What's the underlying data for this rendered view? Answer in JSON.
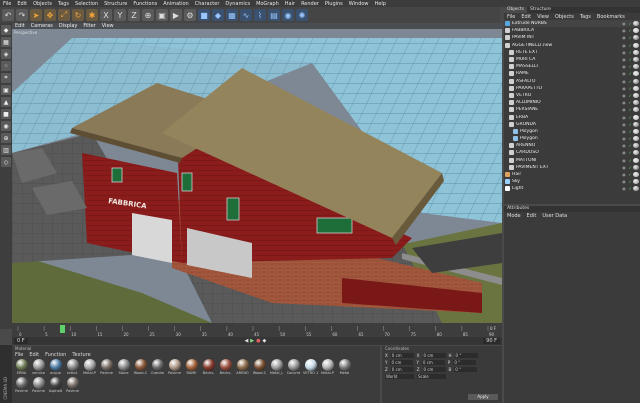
{
  "menubar": [
    "File",
    "Edit",
    "Objects",
    "Tags",
    "Selection",
    "Structure",
    "Functions",
    "Animation",
    "Character",
    "Dynamics",
    "MoGraph",
    "Hair",
    "Render",
    "Plugins",
    "Window",
    "Help"
  ],
  "toolbar_icons": [
    "undo-icon",
    "redo-icon",
    "live-selection-icon",
    "move-icon",
    "scale-icon",
    "rotate-icon",
    "recent-tool-icon",
    "axis-x-icon",
    "axis-y-icon",
    "axis-z-icon",
    "world-coord-icon",
    "render-view-icon",
    "render-picture-icon",
    "render-settings-icon",
    "cube-icon",
    "nurbs-icon",
    "array-icon",
    "spline-icon",
    "deformer-icon",
    "scene-icon",
    "camera-icon",
    "light-icon"
  ],
  "viewport": {
    "menu": [
      "Edit",
      "Cameras",
      "Display",
      "Filter",
      "View"
    ],
    "label": "Perspective"
  },
  "timeline": {
    "ticks": [
      "0",
      "5",
      "10",
      "15",
      "20",
      "25",
      "30",
      "35",
      "40",
      "45",
      "50",
      "55",
      "60",
      "65",
      "70",
      "75",
      "80",
      "85",
      "90"
    ],
    "end_label": "0 F",
    "current_frame": "0 F",
    "end_frame": "90 F"
  },
  "material_manager": {
    "title": "Material",
    "menu": [
      "File",
      "Edit",
      "Function",
      "Texture"
    ],
    "row1": [
      {
        "label": "ERBA",
        "color": "#6f7b55"
      },
      {
        "label": "vernice",
        "color": "#9a9a9a"
      },
      {
        "label": "acqua",
        "color": "#4c7ca4"
      },
      {
        "label": "tetto1",
        "color": "#8a8a8a"
      },
      {
        "label": "Metal-P",
        "color": "#aaaaaa"
      },
      {
        "label": "Pavime",
        "color": "#7a6f66"
      },
      {
        "label": "Stone",
        "color": "#8c8c8c"
      },
      {
        "label": "Wood-C",
        "color": "#8a5a3a"
      },
      {
        "label": "Granite",
        "color": "#6b6b6b"
      },
      {
        "label": "Pavime",
        "color": "#b09a88"
      },
      {
        "label": "RAME",
        "color": "#a5643c"
      },
      {
        "label": "Bricks-",
        "color": "#8a3c2e"
      },
      {
        "label": "Bricks-",
        "color": "#9a5040"
      },
      {
        "label": "ARENO",
        "color": "#8c6c4c"
      },
      {
        "label": "Wood-C",
        "color": "#7a5032"
      },
      {
        "label": "Metal_L",
        "color": "#a0a0a0"
      },
      {
        "label": "Concret",
        "color": "#999999"
      },
      {
        "label": "VETRO 1",
        "color": "#c8dce8"
      },
      {
        "label": "Metal-P",
        "color": "#b4b4b4"
      },
      {
        "label": "Metal",
        "color": "#7c7c7c"
      }
    ],
    "row2": [
      {
        "label": "Pavime",
        "color": "#6c6c6c"
      },
      {
        "label": "Pavime",
        "color": "#8c8c8c"
      },
      {
        "label": "Asphalt",
        "color": "#4a4a4a"
      },
      {
        "label": "Pavime",
        "color": "#7a7068"
      }
    ]
  },
  "coordinates": {
    "title": "Coordinates",
    "rows": [
      {
        "a": "X",
        "av": "0 cm",
        "b": "X",
        "bv": "0 cm",
        "c": "H",
        "cv": "0 °"
      },
      {
        "a": "Y",
        "av": "0 cm",
        "b": "Y",
        "bv": "0 cm",
        "c": "P",
        "cv": "0 °"
      },
      {
        "a": "Z",
        "av": "0 cm",
        "b": "Z",
        "bv": "0 cm",
        "c": "B",
        "cv": "0 °"
      }
    ],
    "mode1": "World",
    "mode2": "Scale",
    "apply": "Apply"
  },
  "objects": {
    "tabs": [
      "Objects",
      "Structure"
    ],
    "menu": [
      "File",
      "Edit",
      "View",
      "Objects",
      "Tags",
      "Bookmarks"
    ],
    "items": [
      {
        "name": "Extrude NURBS",
        "indent": 0,
        "color": "#55a8e0"
      },
      {
        "name": "FABBRICA",
        "indent": 0,
        "color": "#d0d0d0"
      },
      {
        "name": "PAVIM INT",
        "indent": 0,
        "color": "#d0d0d0"
      },
      {
        "name": "AGGETINELLI.new",
        "indent": 0,
        "color": "#d0d0d0"
      },
      {
        "name": "RETE EXT",
        "indent": 1,
        "color": "#d0d0d0"
      },
      {
        "name": "MURI CA",
        "indent": 1,
        "color": "#d0d0d0"
      },
      {
        "name": "MASSELLI",
        "indent": 1,
        "color": "#d0d0d0"
      },
      {
        "name": "RAME",
        "indent": 1,
        "color": "#d0d0d0"
      },
      {
        "name": "ASFALTO",
        "indent": 1,
        "color": "#d0d0d0"
      },
      {
        "name": "PARAPETTO",
        "indent": 1,
        "color": "#d0d0d0"
      },
      {
        "name": "VETRO",
        "indent": 1,
        "color": "#d0d0d0"
      },
      {
        "name": "ALLUMINIO",
        "indent": 1,
        "color": "#d0d0d0"
      },
      {
        "name": "PERSIANE",
        "indent": 1,
        "color": "#d0d0d0"
      },
      {
        "name": "ERBA",
        "indent": 1,
        "color": "#d0d0d0"
      },
      {
        "name": "GRONDA",
        "indent": 1,
        "color": "#d0d0d0"
      },
      {
        "name": "Polygon",
        "indent": 2,
        "color": "#8fc0e8"
      },
      {
        "name": "Polygon",
        "indent": 2,
        "color": "#8fc0e8"
      },
      {
        "name": "ARENNO",
        "indent": 1,
        "color": "#d0d0d0"
      },
      {
        "name": "CARDOSO",
        "indent": 1,
        "color": "#d0d0d0"
      },
      {
        "name": "MATTONI",
        "indent": 1,
        "color": "#d0d0d0"
      },
      {
        "name": "PAVIMENT EXT",
        "indent": 1,
        "color": "#d0d0d0"
      },
      {
        "name": "Hair",
        "indent": 0,
        "color": "#e0a060"
      },
      {
        "name": "Sky",
        "indent": 0,
        "color": "#9ad0ff"
      },
      {
        "name": "Light",
        "indent": 0,
        "color": "#ffffff"
      }
    ]
  },
  "attributes": {
    "title": "Attributes",
    "menu": [
      "Mode",
      "Edit",
      "User Data"
    ]
  },
  "sidebar_label": "CINEMA 4D"
}
